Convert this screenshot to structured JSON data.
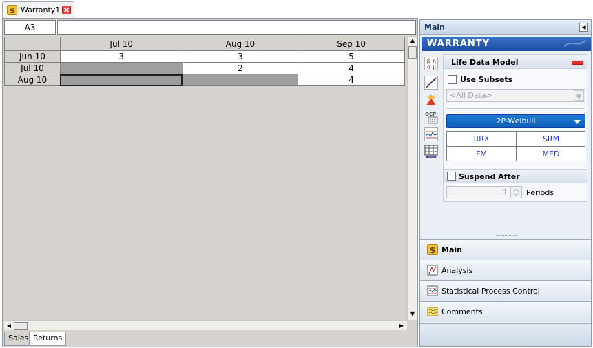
{
  "document_tab": {
    "title": "Warranty1"
  },
  "name_box": {
    "value": "A3"
  },
  "formula_bar": {
    "value": ""
  },
  "sheet": {
    "columns": [
      "Jul 10",
      "Aug 10",
      "Sep 10"
    ],
    "rows": [
      {
        "label": "Jun 10",
        "cells": [
          "3",
          "3",
          "5"
        ]
      },
      {
        "label": "Jul 10",
        "cells": [
          "",
          "2",
          "4"
        ]
      },
      {
        "label": "Aug 10",
        "cells": [
          "",
          "",
          "4"
        ]
      }
    ]
  },
  "sheet_tabs": [
    "Sales",
    "Returns"
  ],
  "panel": {
    "header": "Main",
    "banner": "WARRANTY",
    "life_data_model": {
      "title": "Life Data Model",
      "use_subsets_label": "Use Subsets",
      "subset_placeholder": "<All Data>",
      "distribution": "2P-Weibull",
      "methods": [
        "RRX",
        "SRM",
        "FM",
        "MED"
      ]
    },
    "suspend": {
      "label": "Suspend After",
      "value": "1",
      "unit": "Periods"
    },
    "nav": [
      "Main",
      "Analysis",
      "Statistical Process Control",
      "Comments"
    ]
  },
  "icons": {
    "tab": "dollar-icon",
    "close": "close-icon",
    "tools": [
      "distribution-params-icon",
      "probability-plot-icon",
      "warning-burst-icon",
      "qcp-calculator-icon",
      "control-chart-icon",
      "data-table-icon"
    ]
  },
  "colors": {
    "banner": "#1a4da0",
    "model_button": "#0b5fb8",
    "method_link": "#2a3bbd",
    "shaded_cell": "#9e9e9e"
  }
}
